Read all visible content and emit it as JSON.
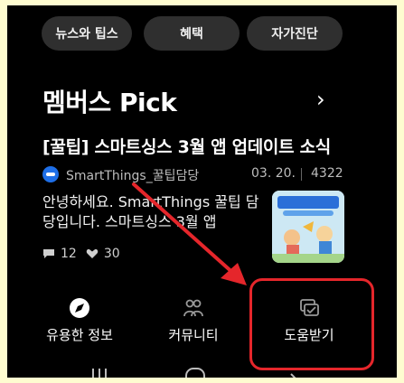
{
  "chips": [
    "뉴스와 팁스",
    "혜택",
    "자가진단"
  ],
  "section": {
    "title": "멤버스 Pick",
    "chevron": "›"
  },
  "post": {
    "title": "[꿀팁] 스마트싱스 3월 앱 업데이트 소식",
    "author": "SmartThings_꿀팁담당",
    "date": "03. 20.",
    "views": "4322",
    "body": "안녕하세요. SmartThings 꿀팁 담당입니다. 스마트싱스 3월 앱",
    "comments": "12",
    "likes": "30"
  },
  "bottom_nav": [
    {
      "label": "유용한 정보",
      "icon": "compass-icon"
    },
    {
      "label": "커뮤니티",
      "icon": "people-icon"
    },
    {
      "label": "도움받기",
      "icon": "chat-check-icon"
    }
  ],
  "colors": {
    "accent_red": "#e5262b",
    "chip_bg": "#2f2f2f",
    "background": "#000000"
  }
}
